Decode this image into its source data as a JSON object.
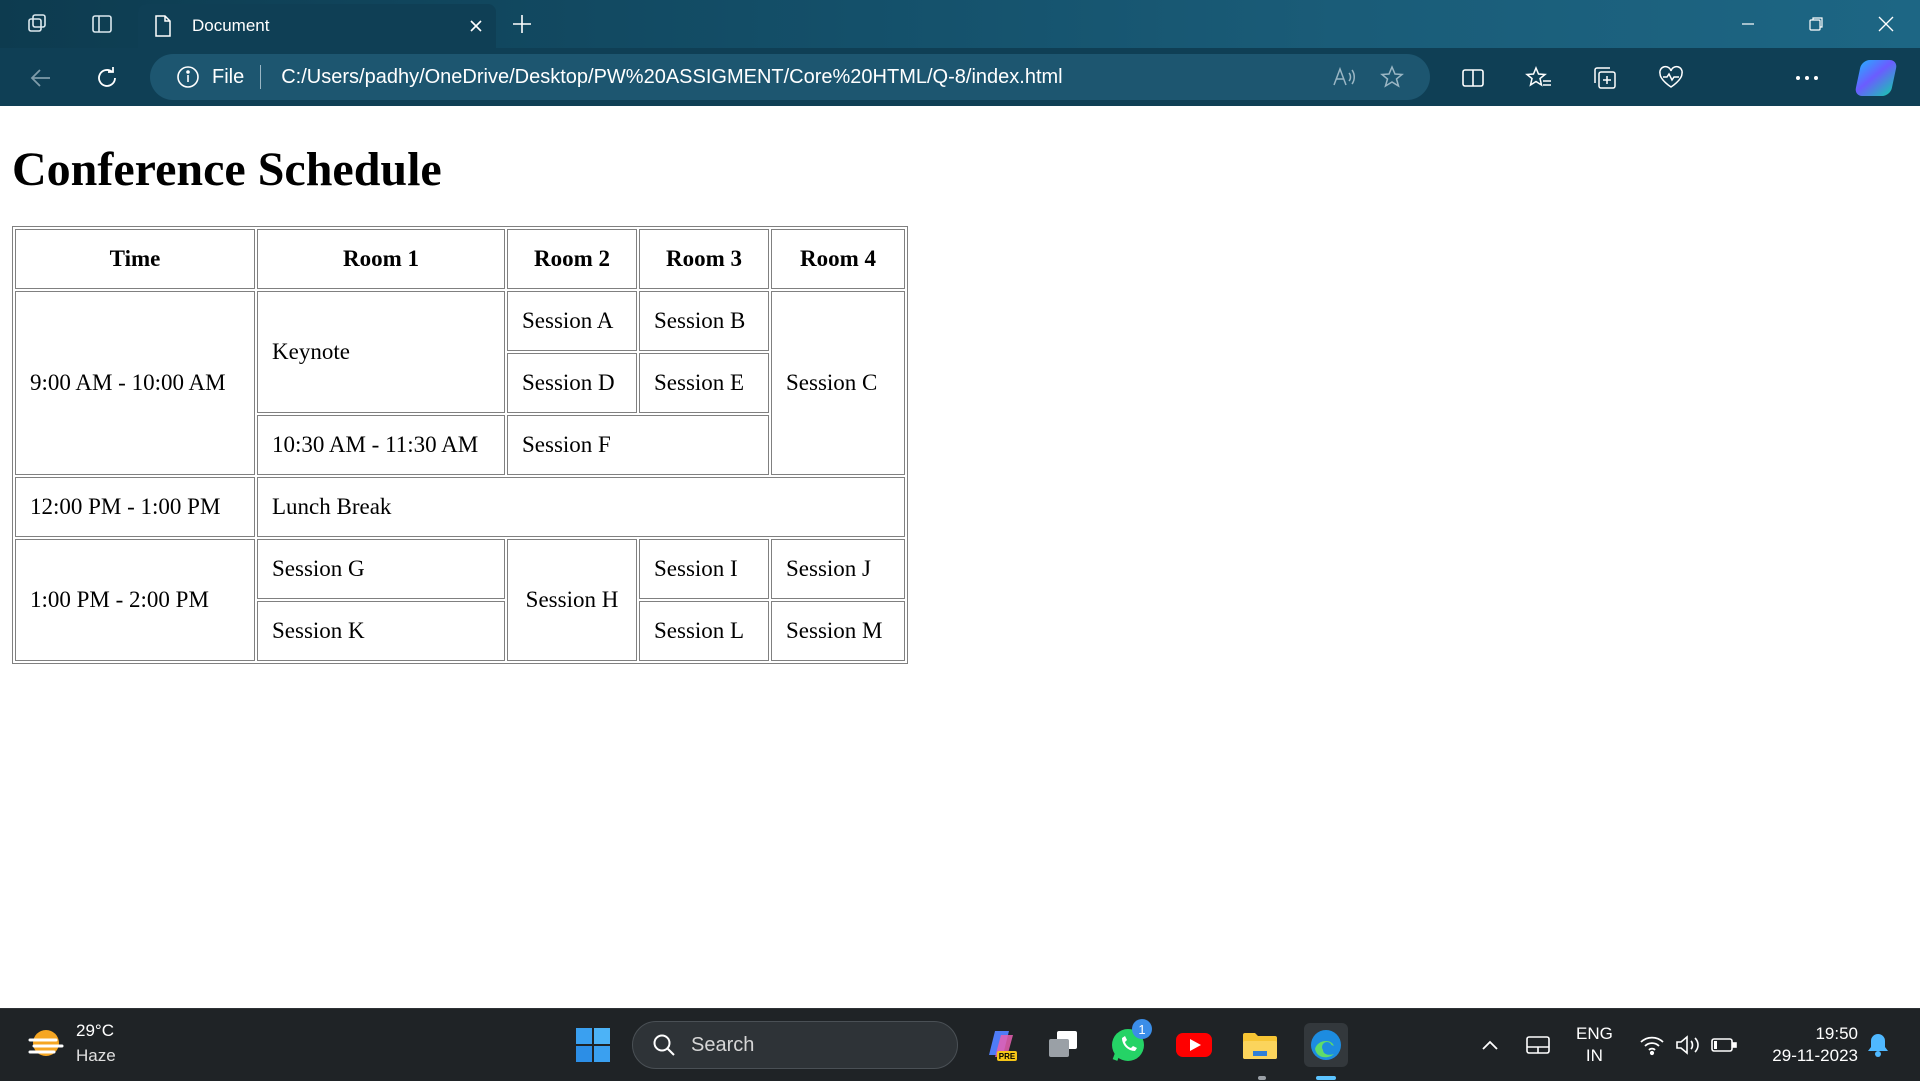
{
  "browser": {
    "tab_title": "Document",
    "address_scheme_label": "File",
    "url": "C:/Users/padhy/OneDrive/Desktop/PW%20ASSIGMENT/Core%20HTML/Q-8/index.html",
    "accent": "#0f3f55"
  },
  "page": {
    "title": "Conference Schedule",
    "schedule": {
      "headers": [
        "Time",
        "Room 1",
        "Room 2",
        "Room 3",
        "Room 4"
      ],
      "cells": {
        "time_1": "9:00 AM - 10:00 AM",
        "keynote": "Keynote",
        "session_a": "Session A",
        "session_b": "Session B",
        "session_c": "Session C",
        "session_d": "Session D",
        "session_e": "Session E",
        "time_2": "10:30 AM - 11:30 AM",
        "session_f": "Session F",
        "time_3": "12:00 PM - 1:00 PM",
        "lunch": "Lunch Break",
        "time_4": "1:00 PM - 2:00 PM",
        "session_g": "Session G",
        "session_h": "Session H",
        "session_i": "Session I",
        "session_j": "Session J",
        "session_k": "Session K",
        "session_l": "Session L",
        "session_m": "Session M"
      }
    }
  },
  "taskbar": {
    "weather_temp": "29°C",
    "weather_desc": "Haze",
    "search_label": "Search",
    "whatsapp_badge": "1",
    "lang_top": "ENG",
    "lang_bottom": "IN",
    "time": "19:50",
    "date": "29-11-2023"
  }
}
